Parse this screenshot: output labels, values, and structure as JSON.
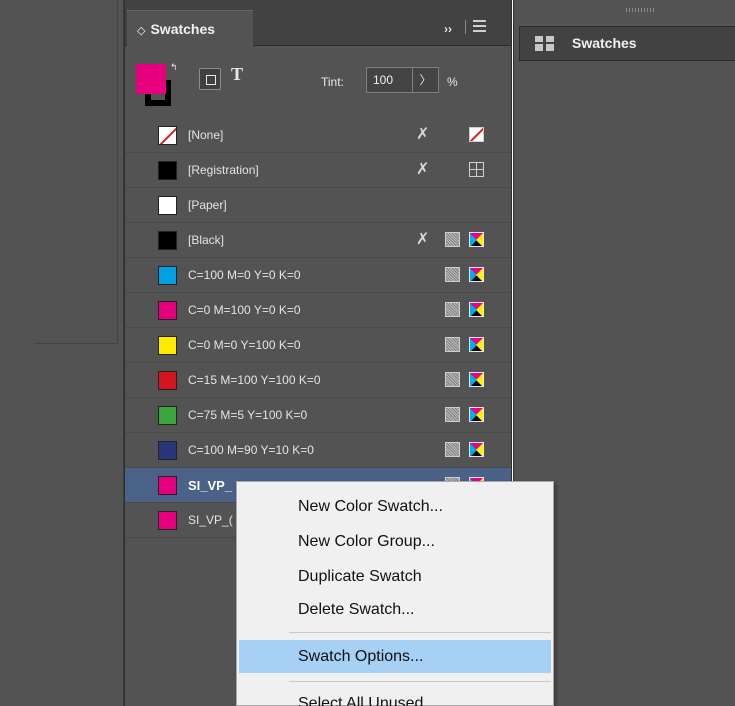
{
  "panel": {
    "tab_title": "Swatches",
    "tab_chevron": "◇",
    "expand_label": "››",
    "tint_label": "Tint:",
    "tint_value": "100",
    "tint_arrow": "〉",
    "tint_unit": "%",
    "fill_color": "#e6007e",
    "text_label": "T"
  },
  "swatches": [
    {
      "name": "[None]",
      "color": "none"
    },
    {
      "name": "[Registration]",
      "color": "#000000"
    },
    {
      "name": "[Paper]",
      "color": "#ffffff"
    },
    {
      "name": "[Black]",
      "color": "#000000"
    },
    {
      "name": "C=100 M=0 Y=0 K=0",
      "color": "#00a0e3"
    },
    {
      "name": "C=0 M=100 Y=0 K=0",
      "color": "#e4007c"
    },
    {
      "name": "C=0 M=0 Y=100 K=0",
      "color": "#ffeb00"
    },
    {
      "name": "C=15 M=100 Y=100 K=0",
      "color": "#d4141f"
    },
    {
      "name": "C=75 M=5 Y=100 K=0",
      "color": "#3aa53a"
    },
    {
      "name": "C=100 M=90 Y=10 K=0",
      "color": "#28347c"
    },
    {
      "name": "SI_VP_",
      "color": "#e6007e",
      "selected": true
    },
    {
      "name": "SI_VP_(",
      "color": "#e6007e"
    }
  ],
  "right_panel": {
    "tab_title": "Swatches"
  },
  "context_menu": {
    "items": [
      {
        "label": "New Color Swatch..."
      },
      {
        "label": "New Color Group..."
      },
      {
        "label": "Duplicate Swatch"
      },
      {
        "label": "Delete Swatch..."
      },
      {
        "label": "Swatch Options...",
        "highlighted": true
      },
      {
        "label": "Select All Unused"
      }
    ]
  }
}
